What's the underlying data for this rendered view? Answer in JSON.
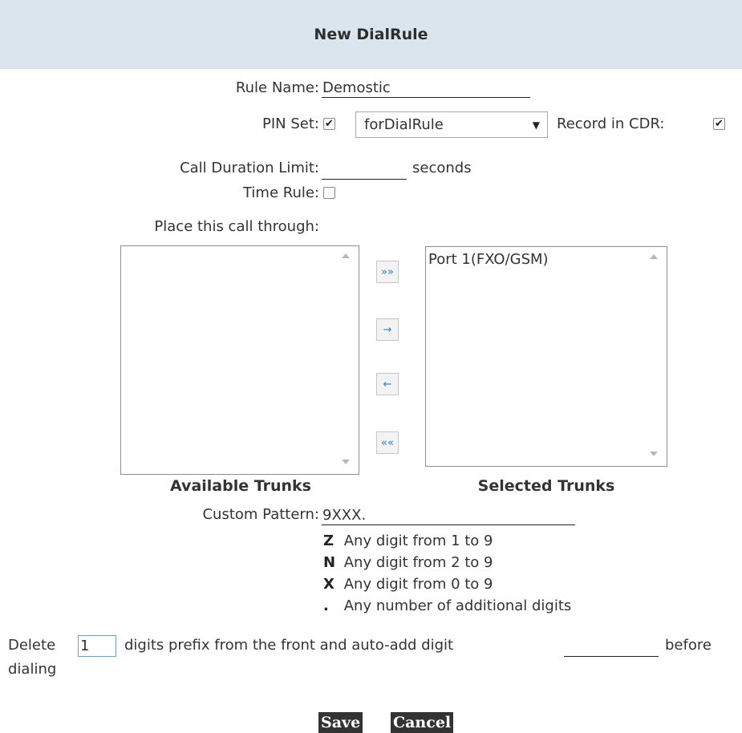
{
  "header": {
    "title": "New DialRule"
  },
  "form": {
    "rule_name": {
      "label": "Rule Name:",
      "value": "Demostic"
    },
    "pin_set": {
      "label": "PIN Set:",
      "checked": true,
      "selected": "forDialRule"
    },
    "record_cdr": {
      "label": "Record in CDR:",
      "checked": true
    },
    "call_duration": {
      "label": "Call Duration Limit:",
      "value": "",
      "unit": "seconds"
    },
    "time_rule": {
      "label": "Time Rule:",
      "checked": false
    },
    "place_call": {
      "label": "Place this call through:"
    }
  },
  "trunks": {
    "available_title": "Available Trunks",
    "available": [],
    "selected_title": "Selected Trunks",
    "selected": [
      "Port 1(FXO/GSM)"
    ],
    "buttons": {
      "add_all": "»»",
      "add": "→",
      "remove": "←",
      "remove_all": "««"
    }
  },
  "pattern": {
    "label": "Custom Pattern:",
    "value": "9XXX.",
    "legend": [
      {
        "key": "Z",
        "desc": "Any digit from 1 to 9"
      },
      {
        "key": "N",
        "desc": "Any digit from 2 to 9"
      },
      {
        "key": "X",
        "desc": "Any digit from 0 to 9"
      },
      {
        "key": ".",
        "desc": "Any number of additional digits"
      }
    ]
  },
  "delete": {
    "prefix": "Delete",
    "value": "1",
    "middle": "digits prefix from the front and auto-add digit",
    "add_value": "",
    "suffix": "before",
    "suffix2": "dialing"
  },
  "actions": {
    "save": "Save",
    "cancel": "Cancel"
  }
}
